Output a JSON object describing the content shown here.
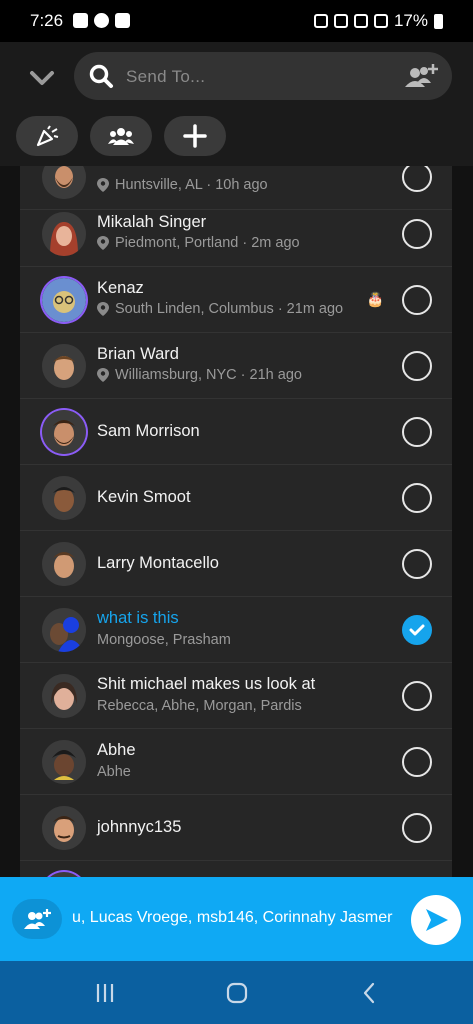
{
  "status": {
    "time": "7:26",
    "battery": "17%"
  },
  "search": {
    "placeholder": "Send To..."
  },
  "rows": [
    {
      "name": "",
      "sub": "Huntsville, AL · 10h ago",
      "checked": false
    },
    {
      "name": "Mikalah Singer",
      "sub": "Piedmont, Portland · 2m ago",
      "checked": false
    },
    {
      "name": "Kenaz",
      "sub": "South Linden, Columbus · 21m ago",
      "checked": false,
      "badge": "🎂"
    },
    {
      "name": "Brian Ward",
      "sub": "Williamsburg, NYC · 21h ago",
      "checked": false
    },
    {
      "name": "Sam Morrison",
      "checked": false
    },
    {
      "name": "Kevin Smoot",
      "checked": false
    },
    {
      "name": "Larry Montacello",
      "checked": false
    },
    {
      "name": "what is this",
      "sub": "Mongoose, Prasham",
      "checked": true
    },
    {
      "name": "Shit michael makes us look at",
      "sub": "Rebecca, Abhe, Morgan, Pardis",
      "checked": false
    },
    {
      "name": "Abhe",
      "sub": "Abhe",
      "checked": false
    },
    {
      "name": "johnnyc135",
      "checked": false
    }
  ],
  "send_bar": {
    "recipients": "u, Lucas Vroege, msb146, Corinnahy Jasmer"
  },
  "colors": {
    "accent": "#0fa9f4",
    "selected_text": "#16a4ec",
    "nav": "#0b60a0"
  }
}
